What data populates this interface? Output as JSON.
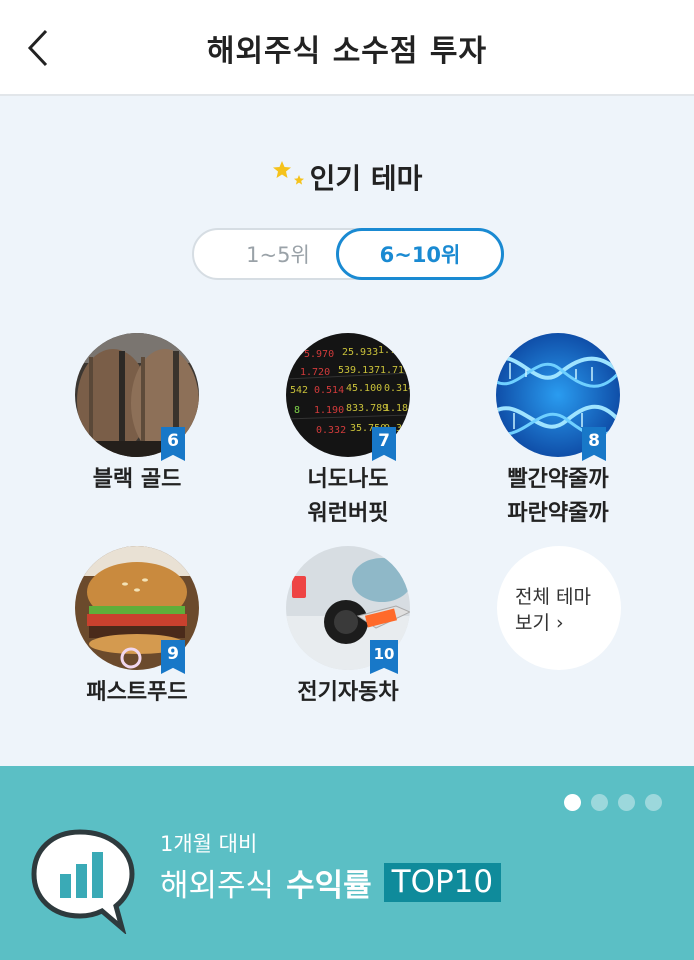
{
  "header": {
    "title": "해외주식 소수점 투자"
  },
  "section": {
    "title": "인기 테마"
  },
  "toggle": {
    "option1": "1~5위",
    "option2": "6~10위",
    "selected": "6~10위"
  },
  "themes": [
    {
      "rank": "6",
      "label_line1": "블랙 골드",
      "label_line2": ""
    },
    {
      "rank": "7",
      "label_line1": "너도나도",
      "label_line2": "워런버핏"
    },
    {
      "rank": "8",
      "label_line1": "빨간약줄까",
      "label_line2": "파란약줄까"
    },
    {
      "rank": "9",
      "label_line1": "패스트푸드",
      "label_line2": ""
    },
    {
      "rank": "10",
      "label_line1": "전기자동차",
      "label_line2": ""
    }
  ],
  "all_themes": {
    "line1": "전체 테마",
    "line2": "보기 ›"
  },
  "banner": {
    "subtitle": "1개월 대비",
    "title_part1": "해외주식",
    "title_part2": "수익률",
    "badge": "TOP10",
    "pages": 4,
    "active_page": 1
  },
  "colors": {
    "accent": "#1a8ad2",
    "badge": "#1878c8",
    "banner_bg": "#5bbfc5",
    "top10_bg": "#0f8b9b",
    "page_bg": "#eef4fa"
  },
  "icons": [
    "back-chevron-icon",
    "stars-icon",
    "chat-bubble-chart-icon"
  ]
}
